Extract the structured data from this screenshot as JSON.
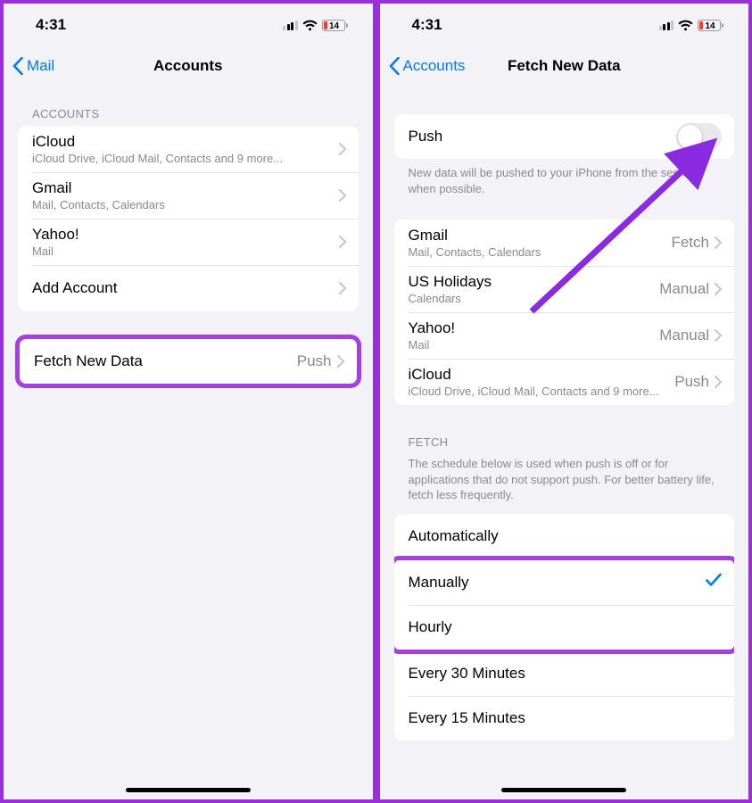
{
  "status": {
    "time": "4:31",
    "battery_pct": "14"
  },
  "left": {
    "back_label": "Mail",
    "title": "Accounts",
    "accounts_header": "ACCOUNTS",
    "accounts": [
      {
        "title": "iCloud",
        "sub": "iCloud Drive, iCloud Mail, Contacts and 9 more..."
      },
      {
        "title": "Gmail",
        "sub": "Mail, Contacts, Calendars"
      },
      {
        "title": "Yahoo!",
        "sub": "Mail"
      }
    ],
    "add_account": "Add Account",
    "fetch_row": {
      "title": "Fetch New Data",
      "value": "Push"
    }
  },
  "right": {
    "back_label": "Accounts",
    "title": "Fetch New Data",
    "push_label": "Push",
    "push_footer": "New data will be pushed to your iPhone from the server when possible.",
    "accounts": [
      {
        "title": "Gmail",
        "sub": "Mail, Contacts, Calendars",
        "value": "Fetch"
      },
      {
        "title": "US Holidays",
        "sub": "Calendars",
        "value": "Manual"
      },
      {
        "title": "Yahoo!",
        "sub": "Mail",
        "value": "Manual"
      },
      {
        "title": "iCloud",
        "sub": "iCloud Drive, iCloud Mail, Contacts and 9 more...",
        "value": "Push"
      }
    ],
    "fetch_header": "FETCH",
    "fetch_footer": "The schedule below is used when push is off or for applications that do not support push. For better battery life, fetch less frequently.",
    "fetch_options": [
      {
        "label": "Automatically",
        "checked": false
      },
      {
        "label": "Manually",
        "checked": true
      },
      {
        "label": "Hourly",
        "checked": false
      },
      {
        "label": "Every 30 Minutes",
        "checked": false
      },
      {
        "label": "Every 15 Minutes",
        "checked": false
      }
    ]
  }
}
